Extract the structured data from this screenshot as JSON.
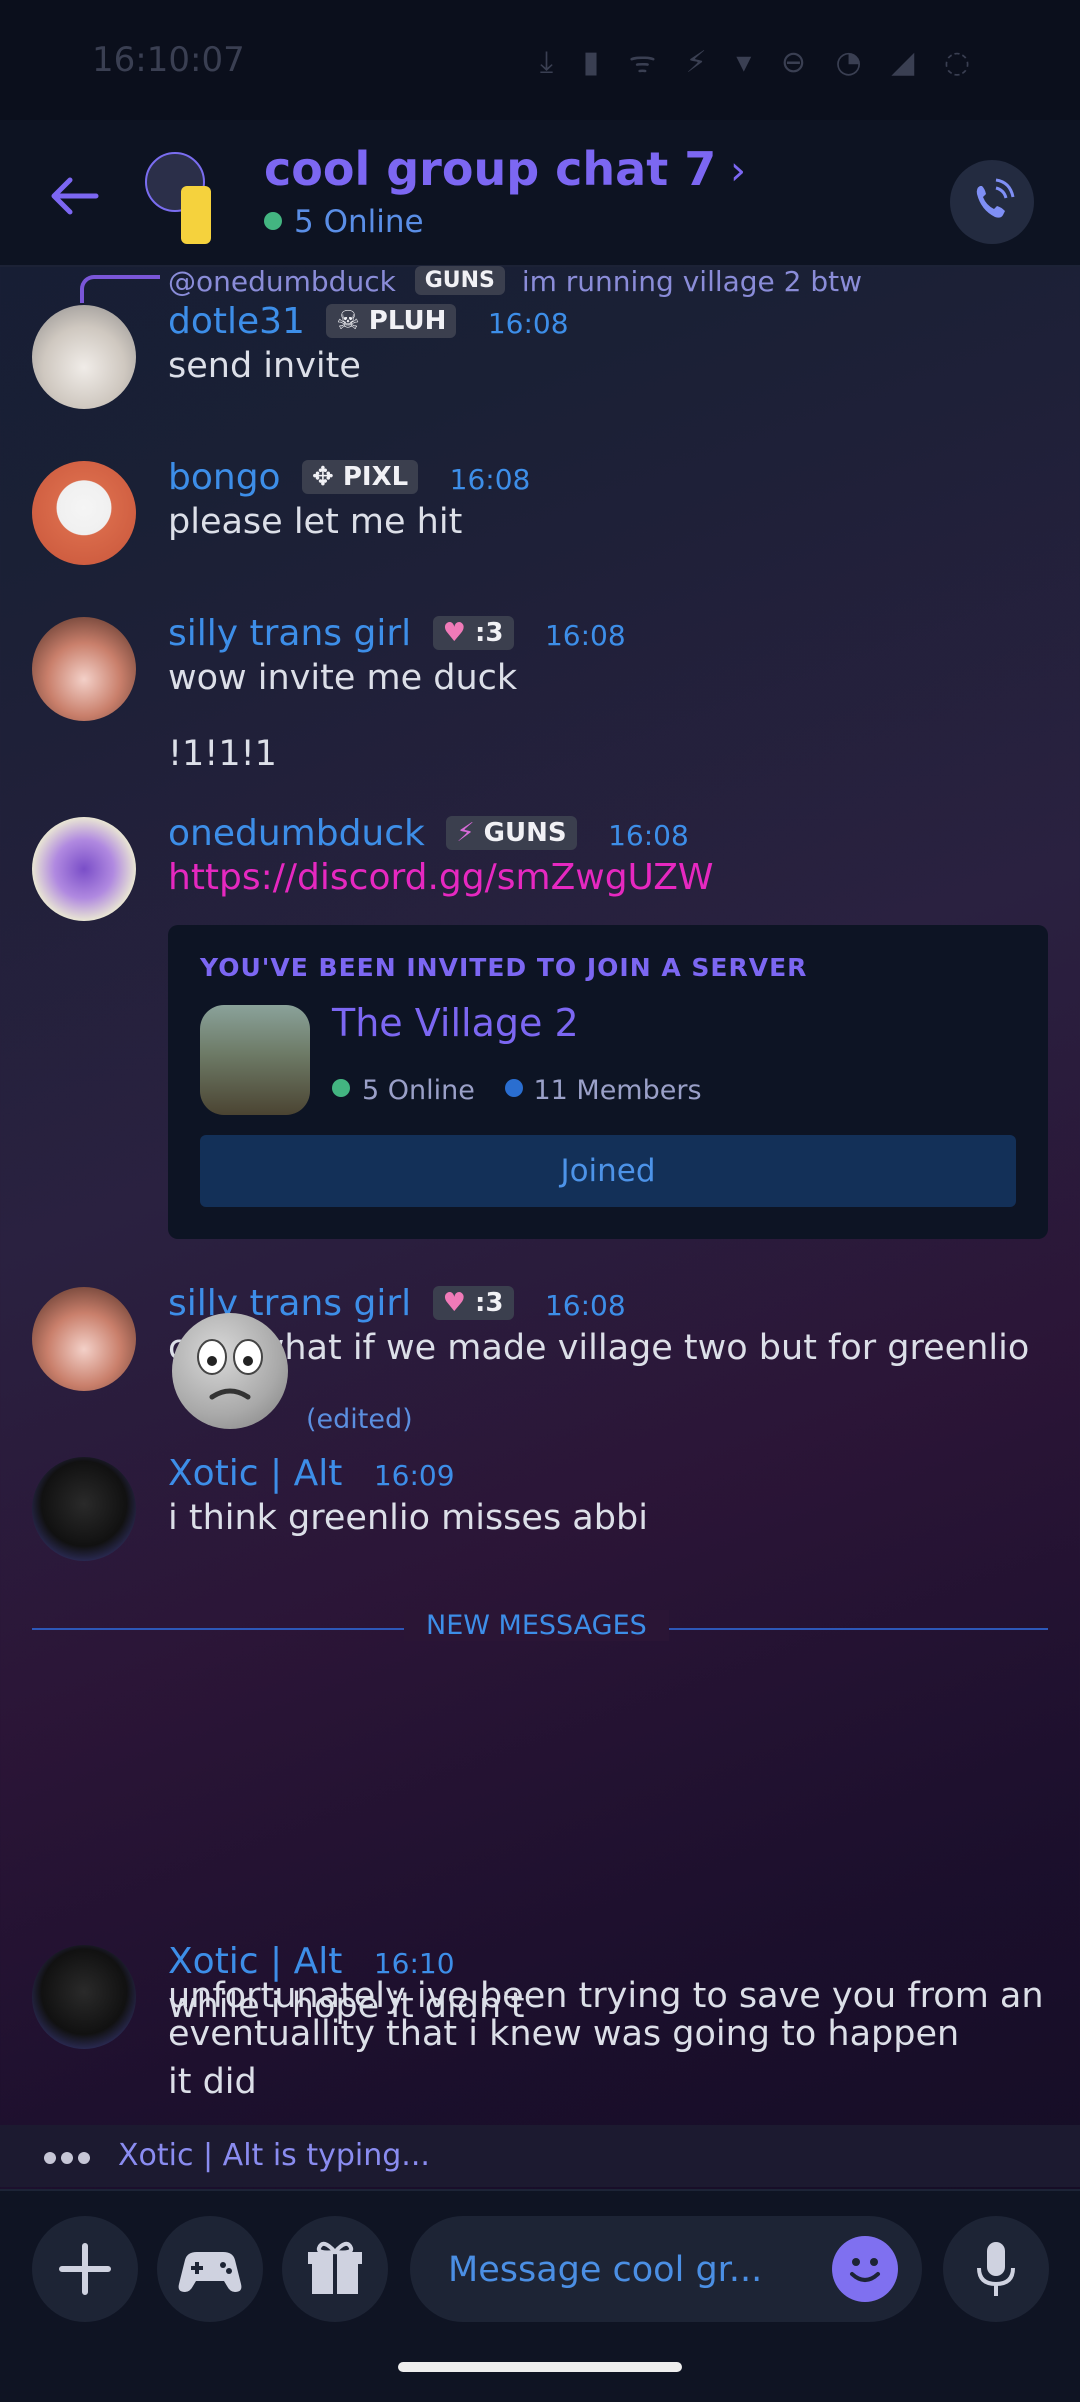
{
  "status_bar": {
    "time": "16:10:07",
    "icons": "⤓ ▮   ᯤ ⚡ ▾ ⊖ ◔ ◢ ◌"
  },
  "header": {
    "title": "cool group chat 7",
    "online": "5 Online"
  },
  "messages": [
    {
      "reply_to": "@onedumbduck",
      "reply_badge": "GUNS",
      "reply_text": "im running village 2 btw",
      "user": "dotle31",
      "badge": "PLUH",
      "time": "16:08",
      "text": "send invite"
    },
    {
      "user": "bongo",
      "badge": "PIXL",
      "time": "16:08",
      "text": "please let me hit"
    },
    {
      "user": "silly trans girl",
      "badge": ":3",
      "time": "16:08",
      "text": "wow invite me duck",
      "text2": "!1!1!1"
    },
    {
      "user": "onedumbduck",
      "badge": "GUNS",
      "time": "16:08",
      "link": "https://discord.gg/smZwgUZW"
    },
    {
      "user": "silly trans girl",
      "badge": ":3",
      "time": "16:08",
      "text": "chat what if we made village two but for greenlio"
    },
    {
      "user": "Xotic | Alt",
      "time": "16:09",
      "text": "i think greenlio misses abbi",
      "edited": "(edited)",
      "text2": "unfortunately ive been trying to save you from an eventuallity that i knew was going to happen"
    },
    {
      "user": "Xotic | Alt",
      "time": "16:10",
      "text": "while i hope it didn't",
      "text2": "it did"
    }
  ],
  "invite": {
    "header": "YOU'VE BEEN INVITED TO JOIN A SERVER",
    "server_name": "The Village 2",
    "online": "5 Online",
    "members": "11 Members",
    "button": "Joined"
  },
  "divider": "NEW MESSAGES",
  "typing": "Xotic | Alt is typing...",
  "composer": {
    "placeholder": "Message cool gr..."
  },
  "colors": {
    "accent": "#7c67f2",
    "username": "#3d8ee8",
    "link": "#e628c0",
    "online": "#43b581"
  }
}
